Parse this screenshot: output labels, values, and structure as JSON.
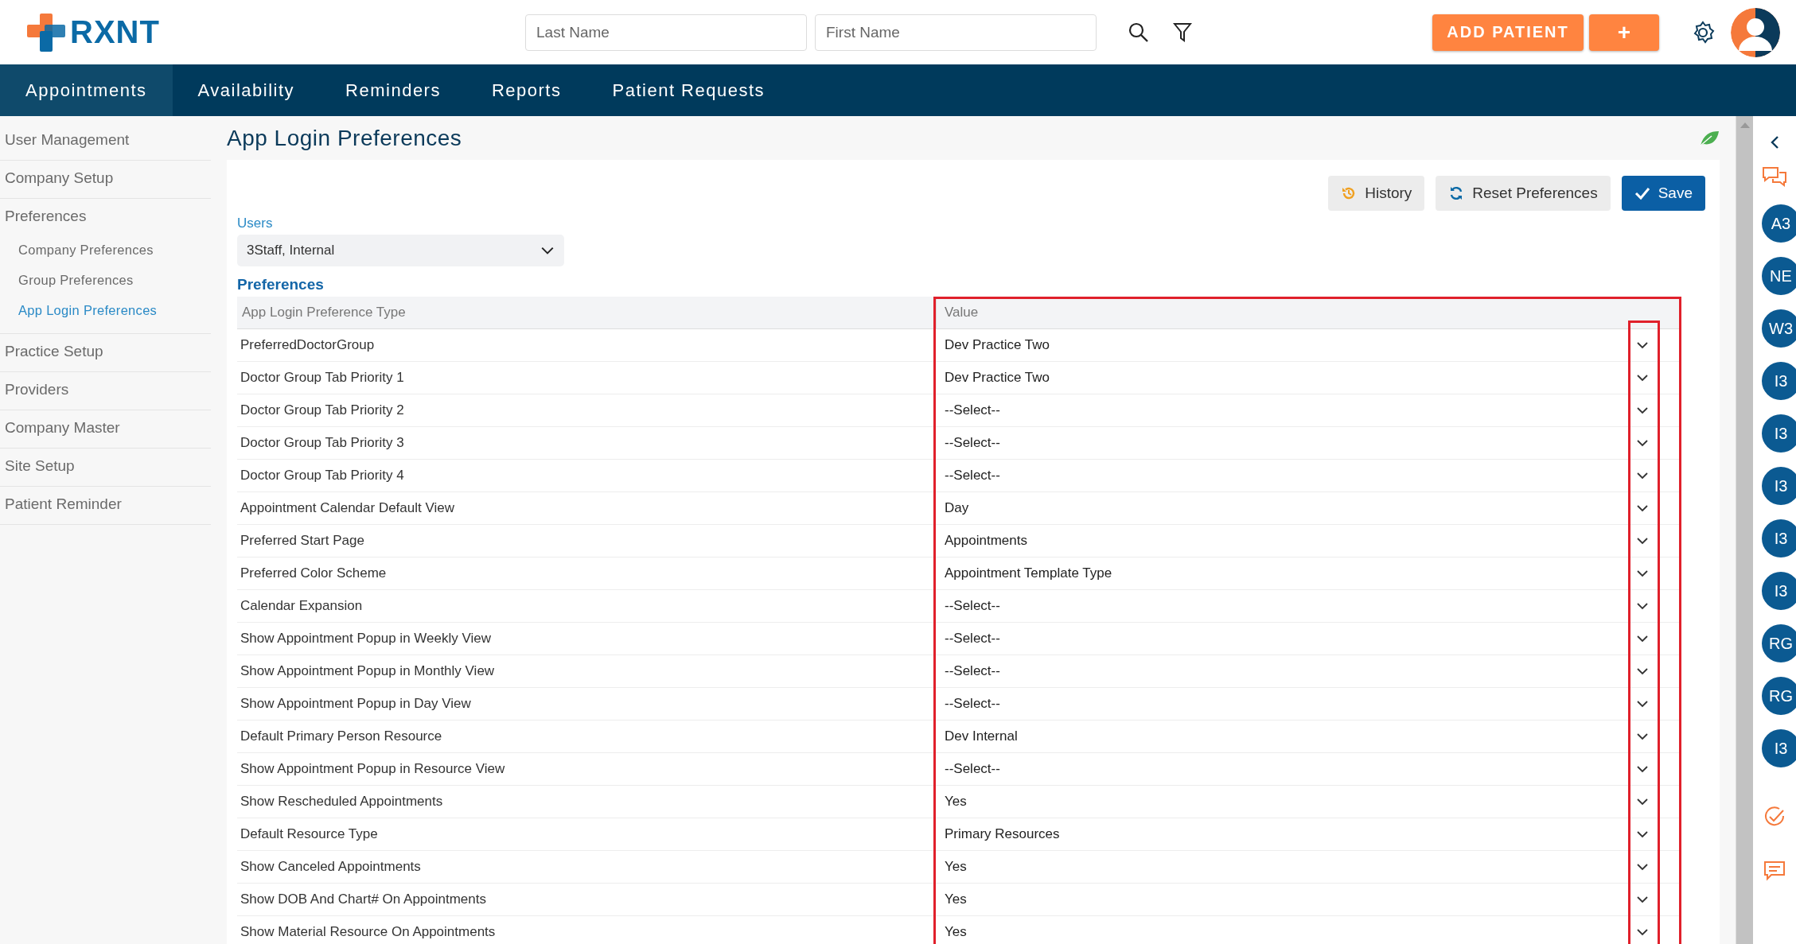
{
  "header": {
    "logo_text": "RXNT",
    "search_fields": [
      {
        "placeholder": "Last Name"
      },
      {
        "placeholder": "First Name"
      }
    ],
    "add_button": "ADD PATIENT",
    "plus_button": "+"
  },
  "nav": [
    {
      "label": "Appointments",
      "selected": true
    },
    {
      "label": "Availability",
      "selected": false
    },
    {
      "label": "Reminders",
      "selected": false
    },
    {
      "label": "Reports",
      "selected": false
    },
    {
      "label": "Patient Requests",
      "selected": false
    }
  ],
  "sidebar": [
    {
      "label": "User Management",
      "selected": false
    },
    {
      "label": "Company Setup",
      "selected": false
    },
    {
      "label": "Preferences",
      "selected": false,
      "children": [
        {
          "label": "Company Preferences",
          "selected": false
        },
        {
          "label": "Group Preferences",
          "selected": false
        },
        {
          "label": "App Login Preferences",
          "selected": true
        }
      ]
    },
    {
      "label": "Practice Setup",
      "selected": false
    },
    {
      "label": "Providers",
      "selected": false
    },
    {
      "label": "Company Master",
      "selected": false
    },
    {
      "label": "Site Setup",
      "selected": false
    },
    {
      "label": "Patient Reminder",
      "selected": false
    }
  ],
  "page_title": "App Login Preferences",
  "actions": [
    {
      "label": "History",
      "kind": "history"
    },
    {
      "label": "Reset Preferences",
      "kind": "reset"
    },
    {
      "label": "Save",
      "kind": "save"
    }
  ],
  "users": {
    "label": "Users",
    "value": "3Staff, Internal"
  },
  "section_title": "Preferences",
  "table": {
    "columns": [
      "App Login Preference Type",
      "Value"
    ],
    "rows": [
      {
        "type": "PreferredDoctorGroup",
        "value": "Dev Practice Two"
      },
      {
        "type": "Doctor Group Tab Priority 1",
        "value": "Dev Practice Two"
      },
      {
        "type": "Doctor Group Tab Priority 2",
        "value": "--Select--"
      },
      {
        "type": "Doctor Group Tab Priority 3",
        "value": "--Select--"
      },
      {
        "type": "Doctor Group Tab Priority 4",
        "value": "--Select--"
      },
      {
        "type": "Appointment Calendar Default View",
        "value": "Day"
      },
      {
        "type": "Preferred Start Page",
        "value": "Appointments"
      },
      {
        "type": "Preferred Color Scheme",
        "value": "Appointment Template Type"
      },
      {
        "type": "Calendar Expansion",
        "value": "--Select--"
      },
      {
        "type": "Show Appointment Popup in Weekly View",
        "value": "--Select--"
      },
      {
        "type": "Show Appointment Popup in Monthly View",
        "value": "--Select--"
      },
      {
        "type": "Show Appointment Popup in Day View",
        "value": "--Select--"
      },
      {
        "type": "Default Primary Person Resource",
        "value": "Dev Internal"
      },
      {
        "type": "Show Appointment Popup in Resource View",
        "value": "--Select--"
      },
      {
        "type": "Show Rescheduled Appointments",
        "value": "Yes"
      },
      {
        "type": "Default Resource Type",
        "value": "Primary Resources"
      },
      {
        "type": "Show Canceled Appointments",
        "value": "Yes"
      },
      {
        "type": "Show DOB And Chart# On Appointments",
        "value": "Yes"
      },
      {
        "type": "Show Material Resource On Appointments",
        "value": "Yes"
      }
    ]
  },
  "rail_avatars": [
    "A3",
    "NE",
    "W3",
    "I3",
    "I3",
    "I3",
    "I3",
    "I3",
    "RG",
    "RG",
    "I3"
  ]
}
